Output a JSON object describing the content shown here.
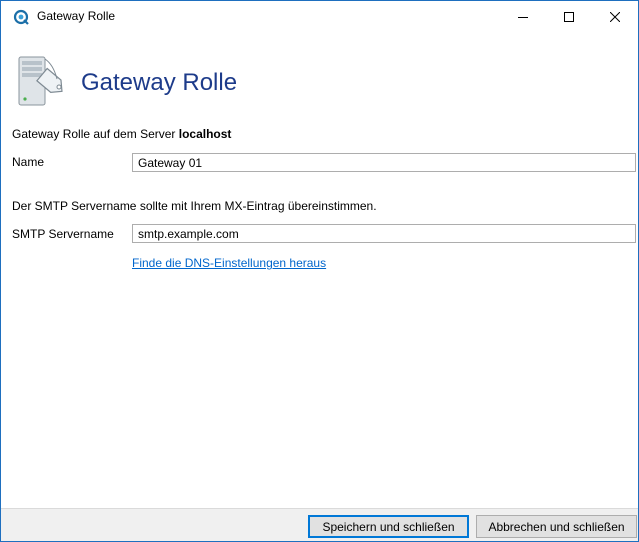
{
  "window": {
    "title": "Gateway Rolle"
  },
  "header": {
    "title": "Gateway Rolle"
  },
  "intro": {
    "prefix": "Gateway Rolle auf dem Server ",
    "server": "localhost"
  },
  "name_field": {
    "label": "Name",
    "value": "Gateway 01"
  },
  "smtp_note": "Der SMTP Servername sollte mit Ihrem MX-Eintrag übereinstimmen.",
  "smtp_field": {
    "label": "SMTP Servername",
    "value": "smtp.example.com"
  },
  "dns_link": "Finde die DNS-Einstellungen heraus",
  "footer": {
    "save_label": "Speichern und schließen",
    "cancel_label": "Abbrechen und schließen"
  },
  "icons": {
    "app": "app-logo-icon",
    "header": "server-tag-icon",
    "minimize": "minimize-icon",
    "maximize": "maximize-icon",
    "close": "close-icon"
  },
  "colors": {
    "accent": "#1d3b8a",
    "link": "#0066cc",
    "window_border": "#1e6fbf",
    "default_button_border": "#0078d7"
  }
}
